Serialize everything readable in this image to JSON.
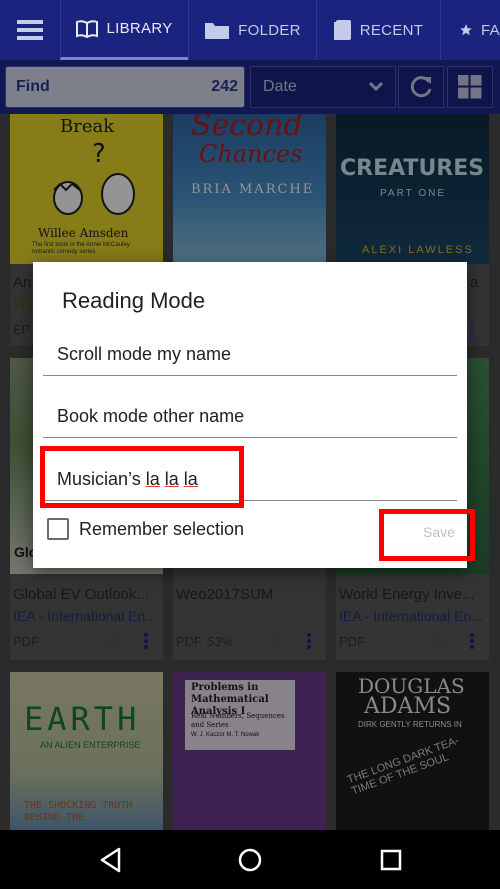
{
  "tabs": {
    "library": "LIBRARY",
    "folder": "FOLDER",
    "recent": "RECENT",
    "favorites": "FA"
  },
  "filter": {
    "find_label": "Find",
    "count": "242",
    "sort_value": "Date"
  },
  "books": [
    {
      "cover_line1": "Break",
      "cover_line2": "Willee Amsden",
      "cover_line3": "The first book in the Annie McCauley romantic comedy series.",
      "title": "An",
      "author": "Wil",
      "format": "EP"
    },
    {
      "cover_line1": "Second",
      "cover_line2": "Chances",
      "cover_line3": "BRIA MARCHE"
    },
    {
      "cover_line1": "CREATURES",
      "cover_line2": "PART ONE",
      "cover_line3": "ALEXI LAWLESS",
      "title_tail": "a"
    },
    {
      "cover_line1": "Glo",
      "title": "Global EV Outlook...",
      "author": "IEA - International En...",
      "format": "PDF"
    },
    {
      "title": "Weo2017SUM",
      "format": "PDF",
      "progress": "53%"
    },
    {
      "title": "World Energy Inve...",
      "author": "IEA - International En...",
      "format": "PDF"
    },
    {
      "cover_line1": "EARTH",
      "cover_line2": "AN ALIEN ENTERPRISE",
      "cover_line3": "THE SHOCKING TRUTH BEHIND THE"
    },
    {
      "cover_line1": "Problems in Mathematical Analysis I",
      "cover_line2": "Real Numbers, Sequences and Series",
      "cover_line3": "W. J. Kaczor  M. T. Nowak"
    },
    {
      "cover_line1": "DOUGLAS",
      "cover_line2": "ADAMS",
      "cover_line3": "DIRK GENTLY RETURNS IN",
      "cover_line4": "THE LONG DARK TEA-TIME OF THE SOUL"
    }
  ],
  "dialog": {
    "title": "Reading Mode",
    "option1": "Scroll mode my name",
    "option2": "Book mode other name",
    "option3_prefix": "Musician’s ",
    "option3_w1": "la",
    "option3_w2": "la",
    "option3_w3": "la",
    "remember_label": "Remember selection",
    "save_label": "Save"
  },
  "colors": {
    "header": "#1a237e",
    "highlight": "#ff0000"
  }
}
